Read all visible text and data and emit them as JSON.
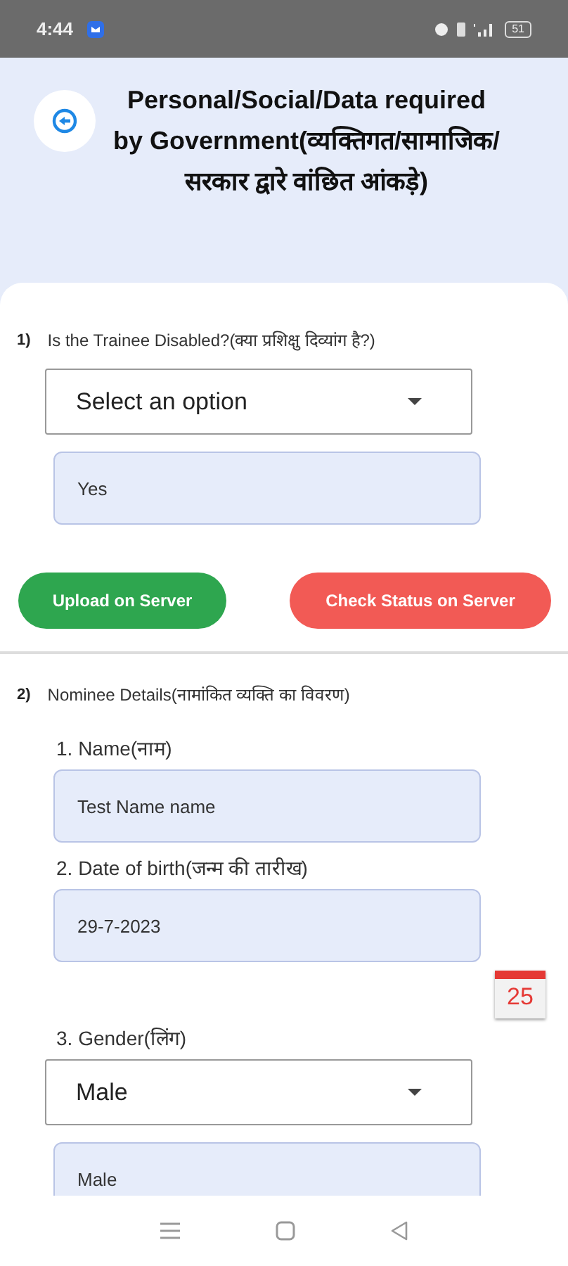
{
  "status_bar": {
    "time": "4:44",
    "battery": "51"
  },
  "header": {
    "title": "Personal/Social/Data required by Government(व्यक्तिगत/सामाजिक/सरकार द्वारे वांछित आंकड़े)"
  },
  "questions": [
    {
      "number": "1)",
      "label": "Is the Trainee Disabled?(क्या प्रशिक्षु दिव्यांग है?)",
      "items": [
        {
          "kind": "dropdown",
          "value": "Select an option"
        },
        {
          "kind": "text",
          "value": "Yes"
        }
      ],
      "buttons": [
        {
          "label": "Upload on Server",
          "kind": "primary"
        },
        {
          "label": "Check Status on Server",
          "kind": "danger"
        }
      ]
    },
    {
      "number": "2)",
      "label": "Nominee Details(नामांकित व्यक्ति का विवरण)",
      "items": [
        {
          "kind": "label",
          "value": "1. Name(नाम)"
        },
        {
          "kind": "text",
          "value": "Test Name name"
        },
        {
          "kind": "label",
          "value": "2. Date of birth(जन्म की तारीख)"
        },
        {
          "kind": "text",
          "value": "29-7-2023"
        },
        {
          "kind": "calendar",
          "value": "25"
        },
        {
          "kind": "label",
          "value": "3. Gender(लिंग)"
        },
        {
          "kind": "dropdown",
          "value": "Male"
        },
        {
          "kind": "text",
          "value": "Male"
        }
      ]
    }
  ]
}
